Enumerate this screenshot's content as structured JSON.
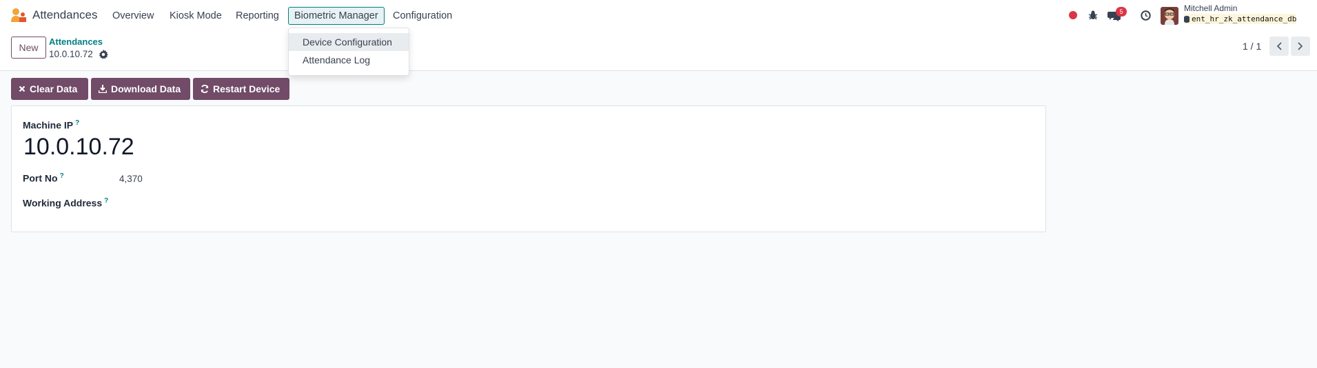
{
  "navbar": {
    "app_name": "Attendances",
    "menus": [
      "Overview",
      "Kiosk Mode",
      "Reporting",
      "Biometric Manager",
      "Configuration"
    ],
    "message_count": "5",
    "user_name": "Mitchell Admin",
    "database": "ent_hr_zk_attendance_db"
  },
  "dropdown": {
    "items": [
      "Device Configuration",
      "Attendance Log"
    ]
  },
  "control": {
    "new_label": "New",
    "breadcrumb": "Attendances",
    "record_name": "10.0.10.72",
    "pager": "1 / 1"
  },
  "actions": {
    "clear": "Clear Data",
    "download": "Download Data",
    "restart": "Restart Device"
  },
  "form": {
    "machine_ip_label": "Machine IP",
    "machine_ip_value": "10.0.10.72",
    "port_label": "Port No",
    "port_value": "4,370",
    "address_label": "Working Address",
    "help_mark": "?"
  },
  "colors": {
    "brand": "#714b67",
    "accent": "#017e84",
    "record_dot": "#dc3545"
  }
}
